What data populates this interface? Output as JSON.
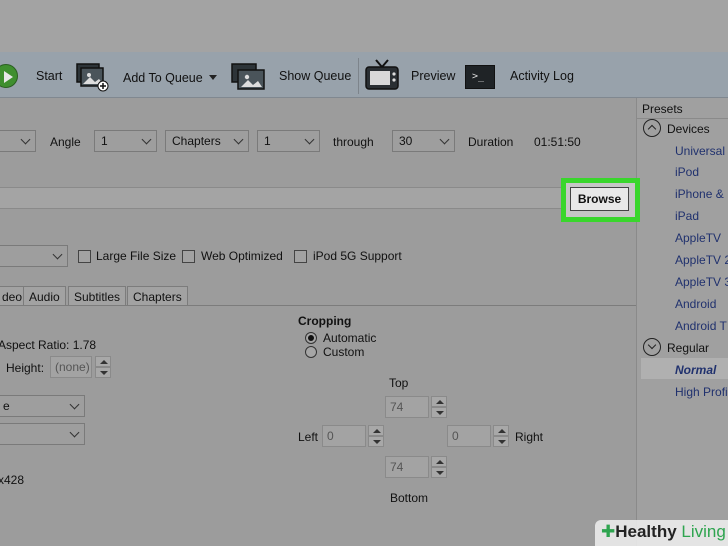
{
  "toolbar": {
    "start": "Start",
    "add_to_queue": "Add To Queue",
    "show_queue": "Show Queue",
    "preview": "Preview",
    "activity_log": "Activity Log"
  },
  "source_row": {
    "angle_label": "Angle",
    "angle_value": "1",
    "range_type": "Chapters",
    "range_start": "1",
    "through_label": "through",
    "range_end": "30",
    "duration_label": "Duration",
    "duration_value": "01:51:50"
  },
  "destination": {
    "browse_label": "Browse"
  },
  "output_options": {
    "large_file_size": "Large File Size",
    "web_optimized": "Web Optimized",
    "ipod_5g_support": "iPod 5G Support"
  },
  "tabs": [
    "deo",
    "Audio",
    "Subtitles",
    "Chapters"
  ],
  "picture": {
    "aspect_ratio": "Aspect Ratio: 1.78",
    "height_label": "Height:",
    "height_placeholder": "(none)",
    "combo1_value": "e",
    "size_text": "x428"
  },
  "cropping": {
    "title": "Cropping",
    "automatic": "Automatic",
    "custom": "Custom",
    "top_label": "Top",
    "left_label": "Left",
    "right_label": "Right",
    "bottom_label": "Bottom",
    "top_value": "74",
    "left_value": "0",
    "right_value": "0",
    "bottom_value": "74"
  },
  "presets": {
    "title": "Presets",
    "groups": [
      {
        "name": "Devices",
        "items": [
          "Universal",
          "iPod",
          "iPhone &",
          "iPad",
          "AppleTV",
          "AppleTV 2",
          "AppleTV 3",
          "Android",
          "Android T"
        ]
      },
      {
        "name": "Regular",
        "items": [
          "Normal",
          "High Profi"
        ]
      }
    ],
    "selected": "Normal"
  },
  "watermark": {
    "prefix": "Healthy",
    "suffix": "Living"
  },
  "colors": {
    "highlight": "#39d62c",
    "preset_link": "#20316e"
  }
}
